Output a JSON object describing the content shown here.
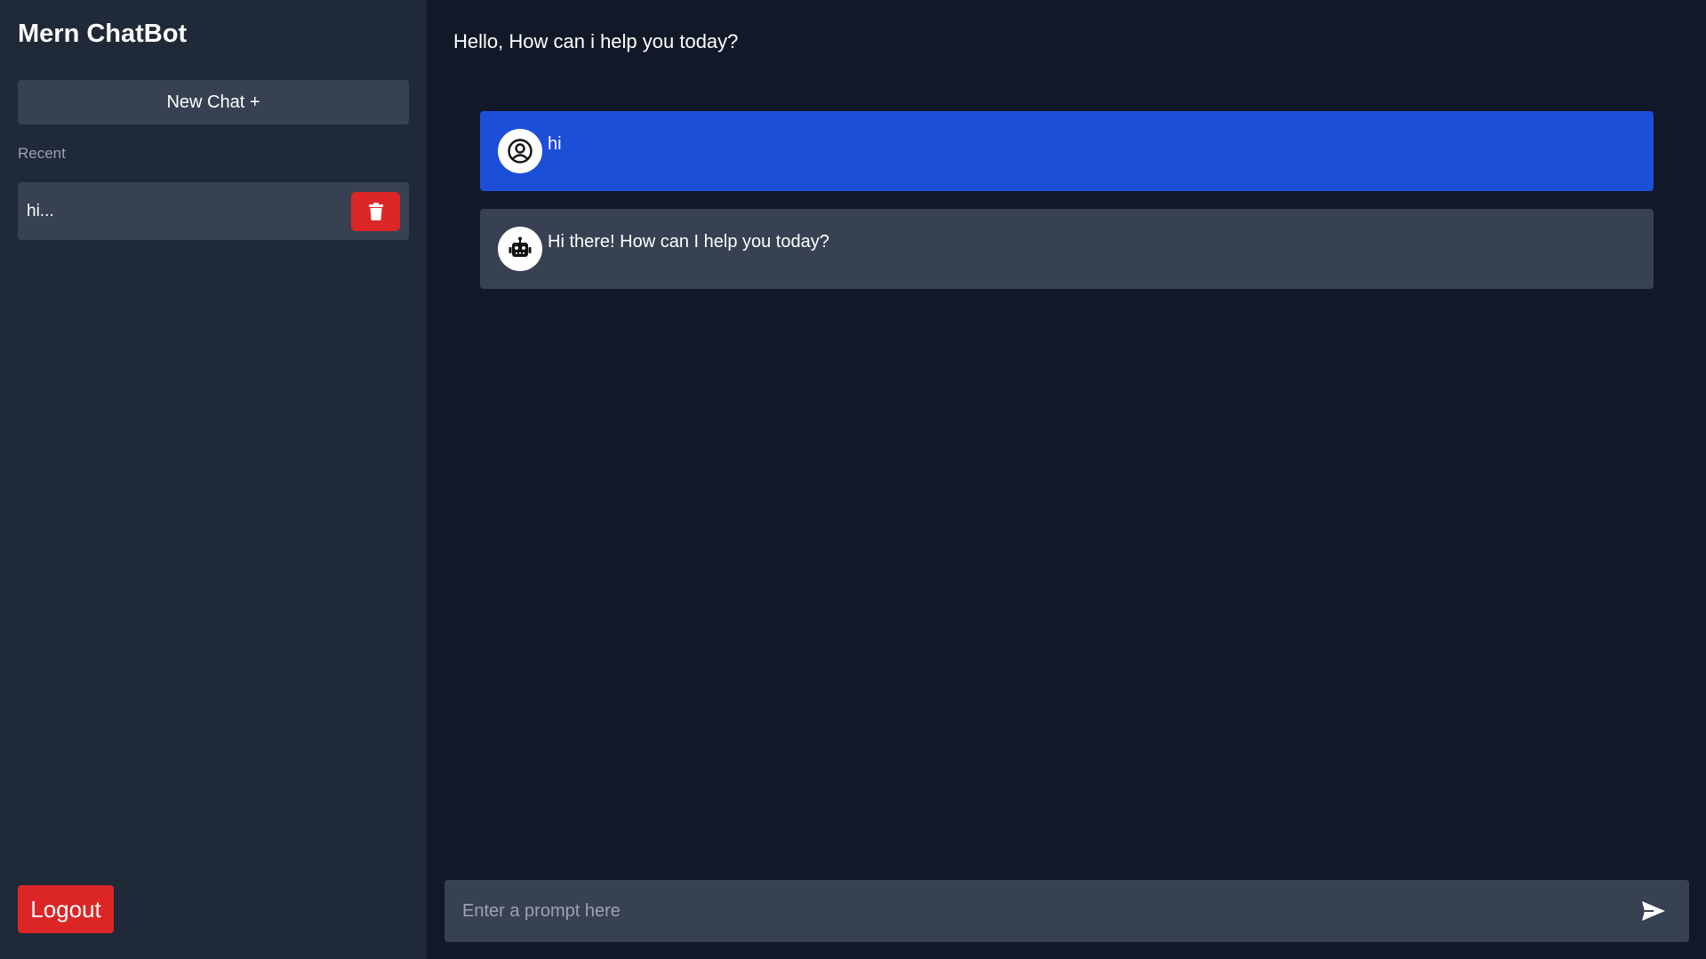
{
  "sidebar": {
    "title": "Mern ChatBot",
    "new_chat_label": "New Chat +",
    "recent_label": "Recent",
    "recent_items": [
      {
        "label": "hi..."
      }
    ],
    "logout_label": "Logout"
  },
  "main": {
    "greeting": "Hello, How can i help you today?",
    "messages": [
      {
        "role": "user",
        "text": "hi",
        "icon": "user-circle-icon"
      },
      {
        "role": "bot",
        "text": "Hi there! How can I help you today?",
        "icon": "robot-icon"
      }
    ],
    "prompt": {
      "placeholder": "Enter a prompt here",
      "value": "",
      "send_icon": "send-icon"
    }
  },
  "colors": {
    "sidebar_bg": "#1f2937",
    "main_bg": "#111827",
    "panel_bg": "#374151",
    "user_message_bg": "#1d4ed8",
    "danger": "#dc2626"
  }
}
